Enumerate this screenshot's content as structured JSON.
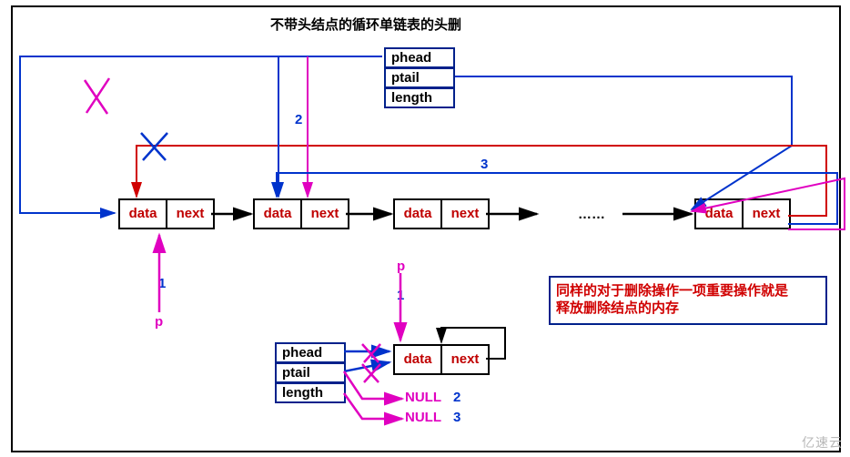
{
  "title": "不带头结点的循环单链表的头删",
  "header1": {
    "phead": "phead",
    "ptail": "ptail",
    "length": "length"
  },
  "nodes": {
    "data": "data",
    "next": "next"
  },
  "dots": "……",
  "labels": {
    "one_a": "1",
    "two": "2",
    "three": "3",
    "p_a": "p",
    "p_b": "p",
    "one_b": "1",
    "null2": "NULL",
    "null3": "NULL",
    "n2": "2",
    "n3": "3"
  },
  "header2": {
    "phead": "phead",
    "ptail": "ptail",
    "length": "length"
  },
  "note_line1": "同样的对于删除操作一项重要操作就是",
  "note_line2": "释放删除结点的内存",
  "watermark": "亿速云"
}
